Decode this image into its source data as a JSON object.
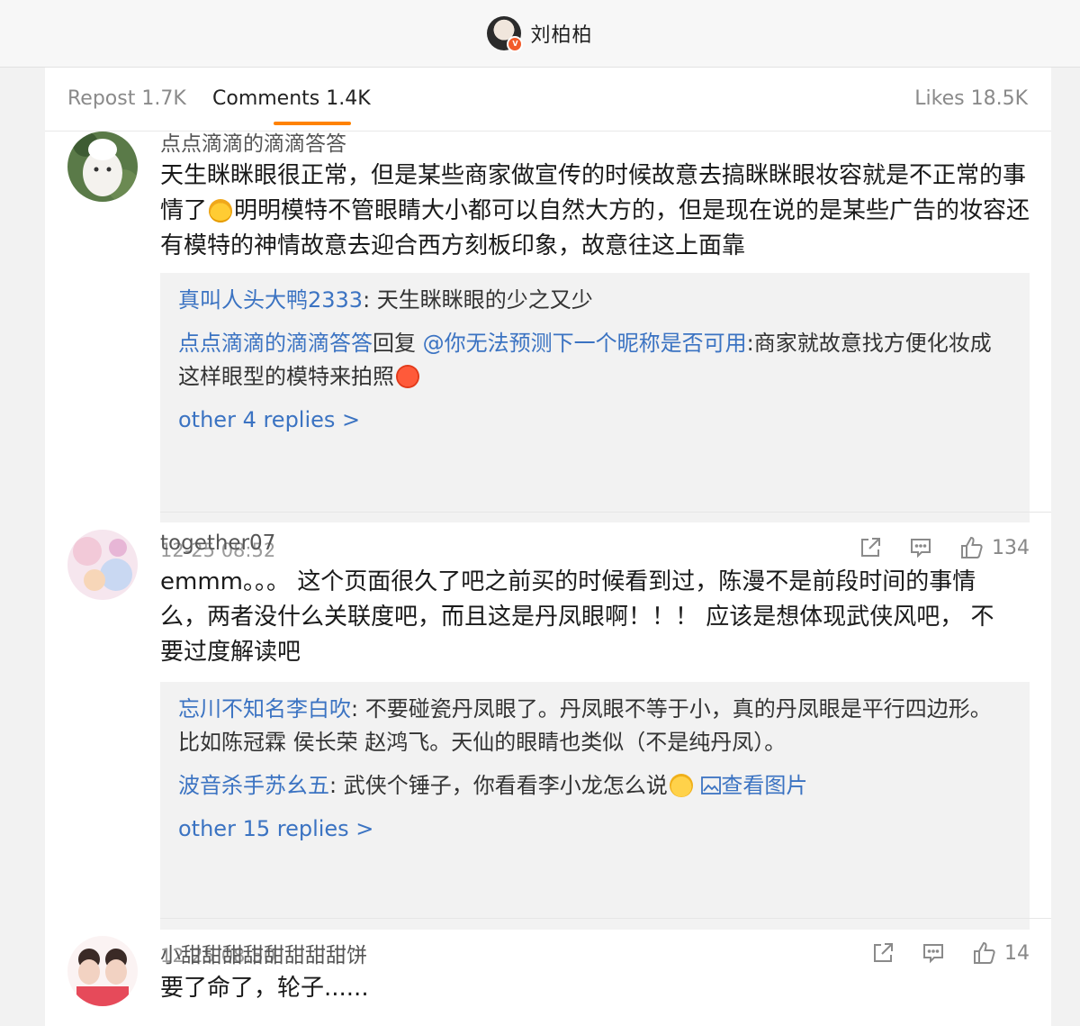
{
  "header": {
    "title": "刘柏柏",
    "badge": "V"
  },
  "tabs": {
    "repost": "Repost 1.7K",
    "comments": "Comments 1.4K",
    "likes": "Likes 18.5K"
  },
  "comments": [
    {
      "name": "点点滴滴的滴滴答答",
      "text": "天生眯眯眼很正常，但是某些商家做宣传的时候故意去搞眯眯眼妆容就是不正常的事情了",
      "text_after_emoji": "明明模特不管眼睛大小都可以自然大方的，但是现在说的是某些广告的妆容还有模特的神情故意去迎合西方刻板印象，故意往这上面靠",
      "replies": [
        {
          "user": "真叫人头大鸭2333",
          "sep": ": ",
          "text": "天生眯眯眼的少之又少"
        },
        {
          "user": "点点滴滴的滴滴答答",
          "mid": "回复 ",
          "mention": "@你无法预测下一个昵称是否可用",
          "text": ":商家就故意找方便化妆成这样眼型的模特来拍照"
        }
      ],
      "more": "other 4 replies >",
      "time": "12-25 08:52",
      "likes": "134"
    },
    {
      "name": "together07",
      "text": "emmm。。。 这个页面很久了吧之前买的时候看到过，陈漫不是前段时间的事情么，两者没什么关联度吧，而且这是丹凤眼啊！！！ 应该是想体现武侠风吧， 不要过度解读吧",
      "replies": [
        {
          "user": "忘川不知名李白吹",
          "sep": ": ",
          "text": "不要碰瓷丹凤眼了。丹凤眼不等于小，真的丹凤眼是平行四边形。比如陈冠霖 侯长荣 赵鸿飞。天仙的眼睛也类似（不是纯丹凤）。"
        },
        {
          "user": "波音杀手苏幺五",
          "sep": ": ",
          "text": "武侠个锤子，你看看李小龙怎么说",
          "link": "查看图片"
        }
      ],
      "more": "other 15 replies >",
      "time": "12-25 08:50",
      "likes": "14"
    },
    {
      "name": "小甜甜甜甜甜甜甜甜饼",
      "text": "要了命了，轮子......"
    }
  ]
}
